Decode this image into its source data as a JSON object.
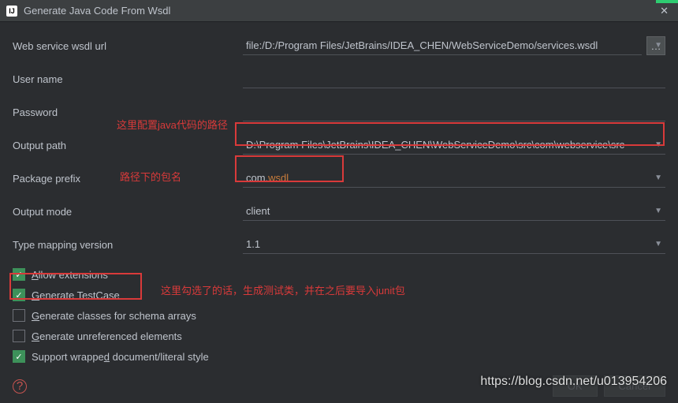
{
  "window": {
    "title": "Generate Java Code From Wsdl"
  },
  "fields": {
    "wsdl_label": "Web service wsdl url",
    "wsdl_value": "file:/D:/Program Files/JetBrains/IDEA_CHEN/WebServiceDemo/services.wsdl",
    "user_label": "User name",
    "pass_label": "Password",
    "output_label": "Output path",
    "output_value": "D:\\Program Files\\JetBrains\\IDEA_CHEN\\WebServiceDemo\\src\\com\\webservice\\src",
    "pkg_label": "Package prefix",
    "pkg_prefix": "com.",
    "pkg_suffix": "wsdl",
    "mode_label": "Output mode",
    "mode_value": "client",
    "tmv_label": "Type mapping version",
    "tmv_value": "1.1"
  },
  "checks": {
    "allow_ext": "Allow extensions",
    "allow_ext_u": "A",
    "gen_test_u": "G",
    "gen_test": "enerate TestCase",
    "gen_cls_u": "G",
    "gen_cls": "enerate classes for schema arrays",
    "gen_unr_u": "G",
    "gen_unr": "enerate unreferenced elements",
    "support": "Support wrappe",
    "support_u": "d",
    "support_rest": " document/literal style"
  },
  "buttons": {
    "ok": "OK",
    "cancel": "Cancel"
  },
  "annotations": {
    "a1": "这里配置java代码的路径",
    "a2": "路径下的包名",
    "a3": "这里勾选了的话，生成测试类，并在之后要导入junit包"
  },
  "watermark": "https://blog.csdn.net/u013954206"
}
